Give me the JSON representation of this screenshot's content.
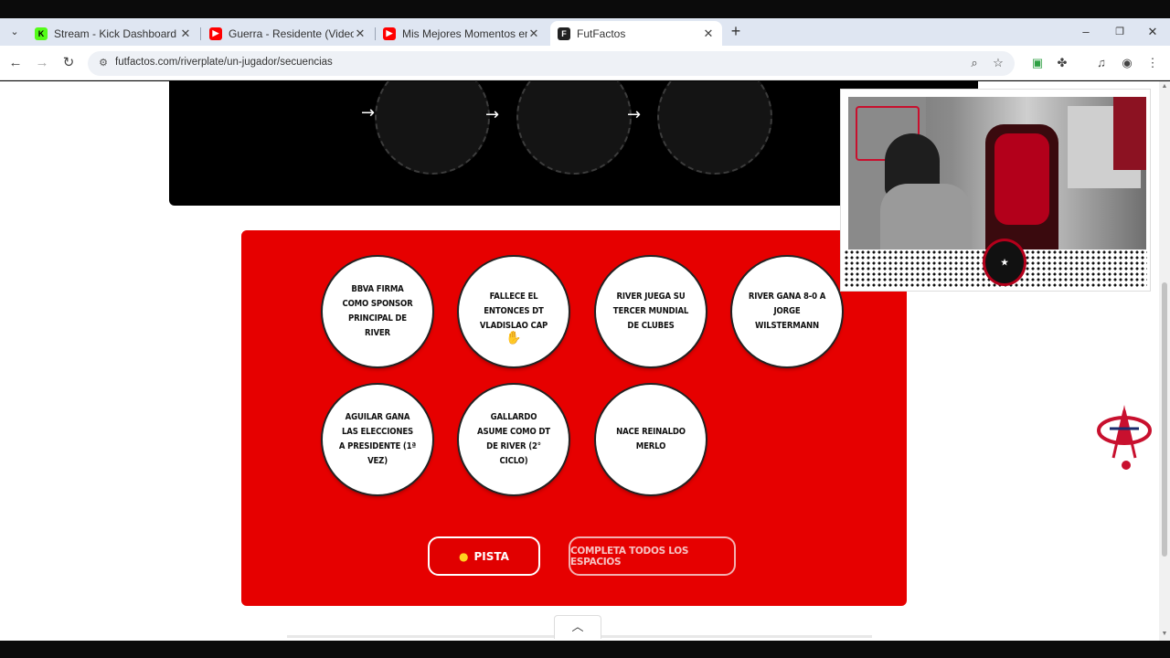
{
  "browser": {
    "tabs": [
      {
        "title": "Stream - Kick Dashboard",
        "icon": "kick-icon",
        "active": false
      },
      {
        "title": "Guerra - Residente (Video Oficial)",
        "icon": "youtube-icon",
        "active": false
      },
      {
        "title": "Mis Mejores Momentos en Fútbol",
        "icon": "youtube-icon",
        "active": false
      },
      {
        "title": "FutFactos",
        "icon": "futfactos-icon",
        "active": true
      }
    ],
    "new_tab": "+",
    "window_controls": {
      "minimize": "–",
      "restore": "❐",
      "close": "✕"
    },
    "url": "futfactos.com/riverplate/un-jugador/secuencias",
    "colors": {
      "tab_bar": "#dfe6f2",
      "omnibox": "#eef1f6"
    }
  },
  "page": {
    "arrows": [
      "→",
      "→",
      "→"
    ],
    "cards": [
      {
        "text": "BBVA FIRMA COMO SPONSOR PRINCIPAL DE RIVER"
      },
      {
        "text": "FALLECE EL ENTONCES DT VLADISLAO CAP"
      },
      {
        "text": "RIVER JUEGA SU TERCER MUNDIAL DE CLUBES"
      },
      {
        "text": "RIVER GANA 8-0 A JORGE WILSTERMANN"
      },
      {
        "text": "AGUILAR GANA LAS ELECCIONES A PRESIDENTE (1ª VEZ)"
      },
      {
        "text": "GALLARDO ASUME COMO DT DE RIVER (2° CICLO)"
      },
      {
        "text": "NACE REINALDO MERLO"
      }
    ],
    "hint_button": "PISTA",
    "complete_button": "COMPLETA TODOS LOS ESPACIOS",
    "colors": {
      "accent_red": "#e60000",
      "dark_block": "#000000"
    }
  }
}
